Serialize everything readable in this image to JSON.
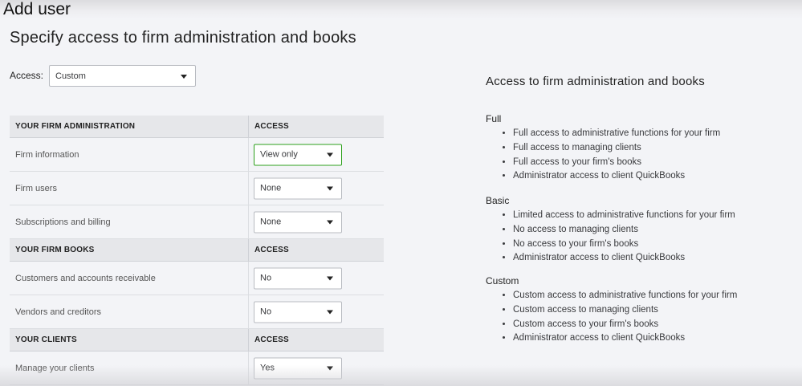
{
  "window": {
    "title": "Add user"
  },
  "page": {
    "title": "Specify access to firm administration and books"
  },
  "access": {
    "label": "Access:",
    "value": "Custom"
  },
  "sections": [
    {
      "header": "YOUR FIRM ADMINISTRATION",
      "access_header": "ACCESS",
      "rows": [
        {
          "label": "Firm information",
          "value": "View only"
        },
        {
          "label": "Firm users",
          "value": "None"
        },
        {
          "label": "Subscriptions and billing",
          "value": "None"
        }
      ]
    },
    {
      "header": "YOUR FIRM BOOKS",
      "access_header": "ACCESS",
      "rows": [
        {
          "label": "Customers and accounts receivable",
          "value": "No"
        },
        {
          "label": "Vendors and creditors",
          "value": "No"
        }
      ]
    },
    {
      "header": "YOUR CLIENTS",
      "access_header": "ACCESS",
      "rows": [
        {
          "label": "Manage your clients",
          "value": "Yes"
        }
      ]
    }
  ],
  "info": {
    "title": "Access to firm administration and books",
    "groups": [
      {
        "title": "Full",
        "items": [
          "Full access to administrative functions for your firm",
          "Full access to managing clients",
          "Full access to your firm's books",
          "Administrator access to client QuickBooks"
        ]
      },
      {
        "title": "Basic",
        "items": [
          "Limited access to administrative functions for your firm",
          "No access to managing clients",
          "No access to your firm's books",
          "Administrator access to client QuickBooks"
        ]
      },
      {
        "title": "Custom",
        "items": [
          "Custom access to administrative functions for your firm",
          "Custom access to managing clients",
          "Custom access to your firm's books",
          "Administrator access to client QuickBooks"
        ]
      }
    ]
  },
  "colors": {
    "background": "#f3f4f7",
    "section_header": "#e6e7ea",
    "focus_border": "#2ca01c",
    "text": "#393a3d"
  },
  "icons": {
    "dropdown": "chevron-down-icon"
  }
}
